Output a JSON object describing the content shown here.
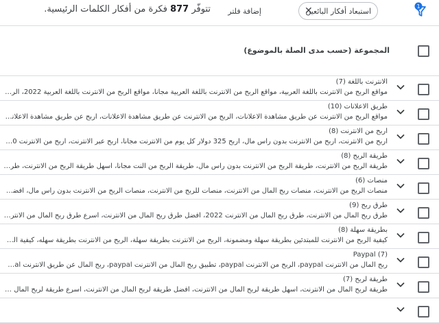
{
  "topbar": {
    "filter_badge": "1",
    "chip_label": "استبعاد أفكار البائعين",
    "clear_filter": "إضافة فلتر",
    "summary_prefix": "تتوفّر",
    "summary_count": "877",
    "summary_suffix": "فكرة من أفكار الكلمات الرئيسية."
  },
  "header": {
    "title": "المجموعة (حسب مدى الصلة بالموضوع)"
  },
  "groups": [
    {
      "title": "الانترنت باللغة (7)",
      "desc": "مواقع الربح من الانترنت باللغة العربية، مواقع الربح من الانترنت باللغة العربية مجانا، مواقع الربح من الانترنت باللغة العربية 2022، الربح من الانترنت باللغة ا..."
    },
    {
      "title": "طريق الاعلانات (10)",
      "desc": "مواقع الربح من الانترنت عن طريق مشاهدة الاعلانات، الربح من الانترنت عن طريق مشاهدة الاعلانات، اربح عن طريق مشاهدة الاعلانات، الربح من الانترنت..."
    },
    {
      "title": "اربح من الانترنت (8)",
      "desc": "اربح من الانترنت، اربح من الانترنت بدون راس مال، اربح 325 دولار كل يوم من الانترنت مجانا، اربح عبر الانترنت، اربح من الانترنت 100 دولار يوميا بدون ..."
    },
    {
      "title": "طريقة الربح (8)",
      "desc": "طريقة الربح من الانترنت، طريقة الربح من الانترنت بدون راس مال، طريقة الربح من النت مجانا، اسهل طريقة الربح من الانترنت، طريقة الربح عبر الانترنت"
    },
    {
      "title": "منصات (6)",
      "desc": "منصات الربح من الانترنت، منصات ربح المال من الانترنت، منصات للربح من الانترنت، منصات الربح من الانترنت بدون راس مال، افضل منصات الربح من الانتر..."
    },
    {
      "title": "طرق ربح (9)",
      "desc": "طرق ربح المال من الانترنت، طرق ربح المال من الانترنت 2022، افضل طرق ربح المال من الانترنت، اسرع طرق ربح المال من الانترنت، اسهل طرق ربح المال"
    },
    {
      "title": "بطريقة سهلة (8)",
      "desc": "كيفية الربح من الانترنت للمبتدئين بطريقة سهلة ومضمونة، الربح من الانترنت بطريقة سهلة، الربح من الانترنت بطريقة سهله، كيفية الربح من الانترنت للمبتد..."
    },
    {
      "title": "Paypal (7)",
      "desc": "ربح المال من الانترنت paypal، الربح من الانترنت paypal، تطبيق ربح المال من الانترنت paypal، ربح المال عن طريق الانترنت paypal، ربح المال من الانترنت"
    },
    {
      "title": "طريقة لربح (7)",
      "desc": "طريقة لربح المال من الانترنت، اسهل طريقة لربح المال من الانترنت، افضل طريقة لربح المال من الانترنت، اسرع طريقة لربح المال من الانترنت، اسهل طريقة..."
    },
    {
      "title": "",
      "desc": ""
    }
  ]
}
